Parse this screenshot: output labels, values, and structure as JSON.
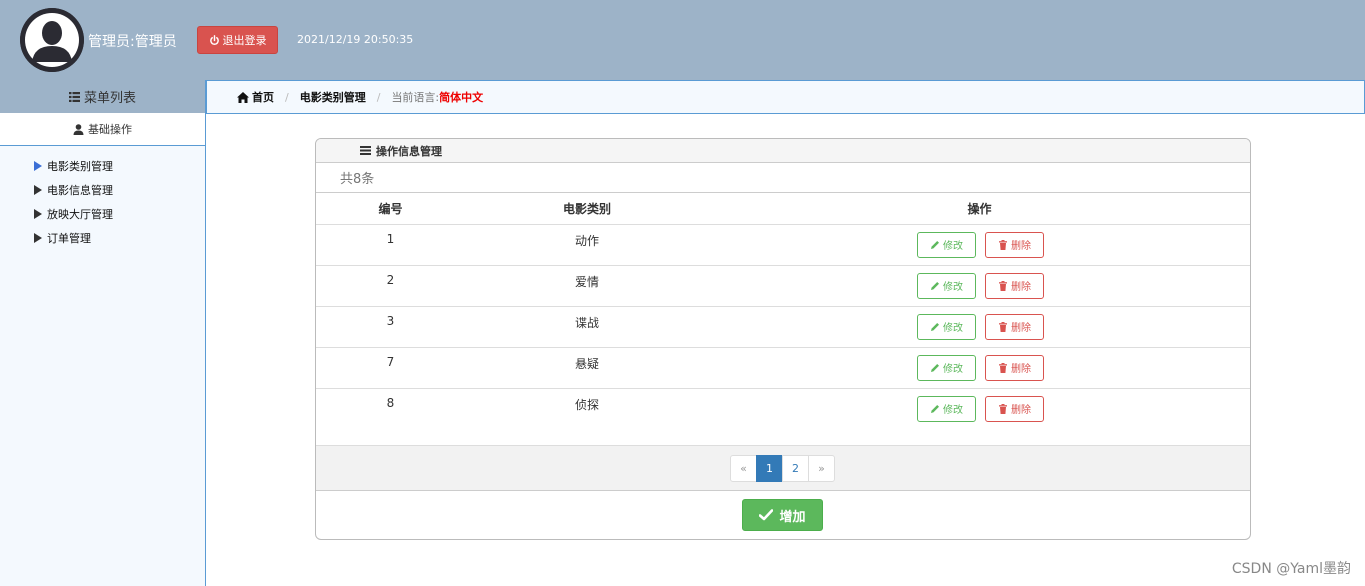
{
  "header": {
    "admin_name": "管理员:管理员",
    "logout_label": "退出登录",
    "datetime": "2021/12/19 20:50:35"
  },
  "sidebar": {
    "menu_title": "菜单列表",
    "section_title": "基础操作",
    "items": [
      {
        "label": "电影类别管理",
        "active": true
      },
      {
        "label": "电影信息管理",
        "active": false
      },
      {
        "label": "放映大厅管理",
        "active": false
      },
      {
        "label": "订单管理",
        "active": false
      }
    ]
  },
  "breadcrumb": {
    "home": "首页",
    "current": "电影类别管理",
    "lang_label": "当前语言:",
    "lang_value": "简体中文"
  },
  "panel": {
    "title": "操作信息管理",
    "total": "共8条",
    "columns": [
      "编号",
      "电影类别",
      "操作"
    ],
    "edit_label": "修改",
    "delete_label": "删除",
    "rows": [
      {
        "id": "1",
        "category": "动作"
      },
      {
        "id": "2",
        "category": "爱情"
      },
      {
        "id": "3",
        "category": "谍战"
      },
      {
        "id": "7",
        "category": "悬疑"
      },
      {
        "id": "8",
        "category": "侦探"
      }
    ],
    "pager": {
      "prev": "«",
      "pages": [
        "1",
        "2"
      ],
      "current": "1",
      "next": "»"
    },
    "add_label": "增加"
  },
  "watermark": "CSDN @Yaml墨韵",
  "colors": {
    "header_bg": "#9db3c8",
    "danger": "#d9534f",
    "success": "#5cb85c",
    "primary": "#337ab7",
    "sidebar_border": "#5a9bd4"
  }
}
